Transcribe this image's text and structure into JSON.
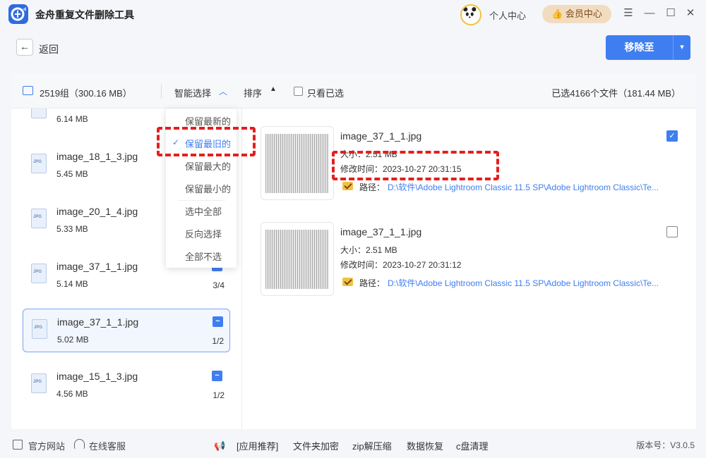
{
  "app": {
    "title": "金舟重复文件删除工具"
  },
  "header": {
    "user_center": "个人中心",
    "vip": "会员中心"
  },
  "nav": {
    "back": "返回"
  },
  "actions": {
    "move_to": "移除至"
  },
  "toolbar": {
    "groups": "2519组（300.16 MB）",
    "smart_select": "智能选择",
    "sort": "排序",
    "only_selected": "只看已选",
    "selected_summary": "已选4166个文件（181.44 MB）"
  },
  "dropdown": {
    "items": [
      "保留最新的",
      "保留最旧的",
      "保留最大的",
      "保留最小的",
      "选中全部",
      "反向选择",
      "全部不选"
    ],
    "selected_index": 1
  },
  "file_list": [
    {
      "name": "",
      "size": "6.14 MB",
      "count": ""
    },
    {
      "name": "image_18_1_3.jpg",
      "size": "5.45 MB",
      "count": ""
    },
    {
      "name": "image_20_1_4.jpg",
      "size": "5.33 MB",
      "count": ""
    },
    {
      "name": "image_37_1_1.jpg",
      "size": "5.14 MB",
      "count": "3/4"
    },
    {
      "name": "image_37_1_1.jpg",
      "size": "5.02 MB",
      "count": "1/2",
      "active": true
    },
    {
      "name": "image_15_1_3.jpg",
      "size": "4.56 MB",
      "count": "1/2"
    }
  ],
  "details": [
    {
      "name": "image_37_1_1.jpg",
      "size": "大小：2.51 MB",
      "time": "修改时间：2023-10-27 20:31:15",
      "path_label": "路径：",
      "path": "D:\\软件\\Adobe Lightroom Classic 11.5 SP\\Adobe Lightroom Classic\\Te...",
      "checked": true
    },
    {
      "name": "image_37_1_1.jpg",
      "size": "大小：2.51 MB",
      "time": "修改时间：2023-10-27 20:31:12",
      "path_label": "路径：",
      "path": "D:\\软件\\Adobe Lightroom Classic 11.5 SP\\Adobe Lightroom Classic\\Te...",
      "checked": false
    }
  ],
  "footer": {
    "official_site": "官方网站",
    "online_service": "在线客服",
    "recommend": "[应用推荐]",
    "links": [
      "文件夹加密",
      "zip解压缩",
      "数据恢复",
      "c盘清理"
    ],
    "version": "版本号：V3.0.5"
  },
  "colors": {
    "accent": "#3f7ef0",
    "highlight": "#e41e1e",
    "vip_bg": "#f2dcc0"
  },
  "icons": [
    "app-logo-icon",
    "back-arrow-icon",
    "chevron-down-icon",
    "image-group-icon",
    "sort-icon",
    "jpg-file-icon",
    "folder-check-icon",
    "website-icon",
    "headset-icon",
    "megaphone-icon",
    "minimize-icon",
    "maximize-icon",
    "close-icon",
    "menu-icon"
  ]
}
